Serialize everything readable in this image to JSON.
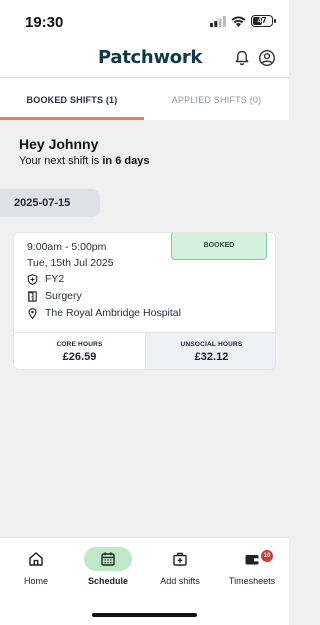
{
  "status_bar": {
    "time": "19:30",
    "battery": "47",
    "battery_level": 0.47
  },
  "header": {
    "logo": "Patchwork",
    "icons": [
      "bell-icon",
      "user-icon"
    ]
  },
  "tabs": [
    {
      "label": "BOOKED SHIFTS (1)",
      "active": true
    },
    {
      "label": "APPLIED SHIFTS (0)",
      "active": false
    }
  ],
  "greeting": {
    "title": "Hey Johnny",
    "subtitle_prefix": "Your next shift is ",
    "subtitle_emphasis": "in 6 days"
  },
  "date_chip": "2025-07-15",
  "shift": {
    "status": "BOOKED",
    "time": "9:00am - 5:00pm",
    "date": "Tue, 15th Jul 2025",
    "grade": "FY2",
    "department": "Surgery",
    "site": "The Royal Ambridge Hospital",
    "core_hours_label": "CORE HOURS",
    "core_hours_value": "£26.59",
    "unsocial_hours_label": "UNSOCIAL HOURS",
    "unsocial_hours_value": "£32.12"
  },
  "bottom_nav": [
    {
      "label": "Home",
      "icon": "home-icon",
      "active": false
    },
    {
      "label": "Schedule",
      "icon": "calendar-icon",
      "active": true
    },
    {
      "label": "Add shifts",
      "icon": "add-shift-icon",
      "active": false
    },
    {
      "label": "Timesheets",
      "icon": "wallet-icon",
      "active": false,
      "badge": "10"
    }
  ],
  "colors": {
    "accent": "#ef7a5a",
    "brand": "#0f3a46",
    "booked_bg": "#d3f1dc",
    "nav_active_bg": "#bde9c9",
    "badge_red": "#c7413a"
  }
}
